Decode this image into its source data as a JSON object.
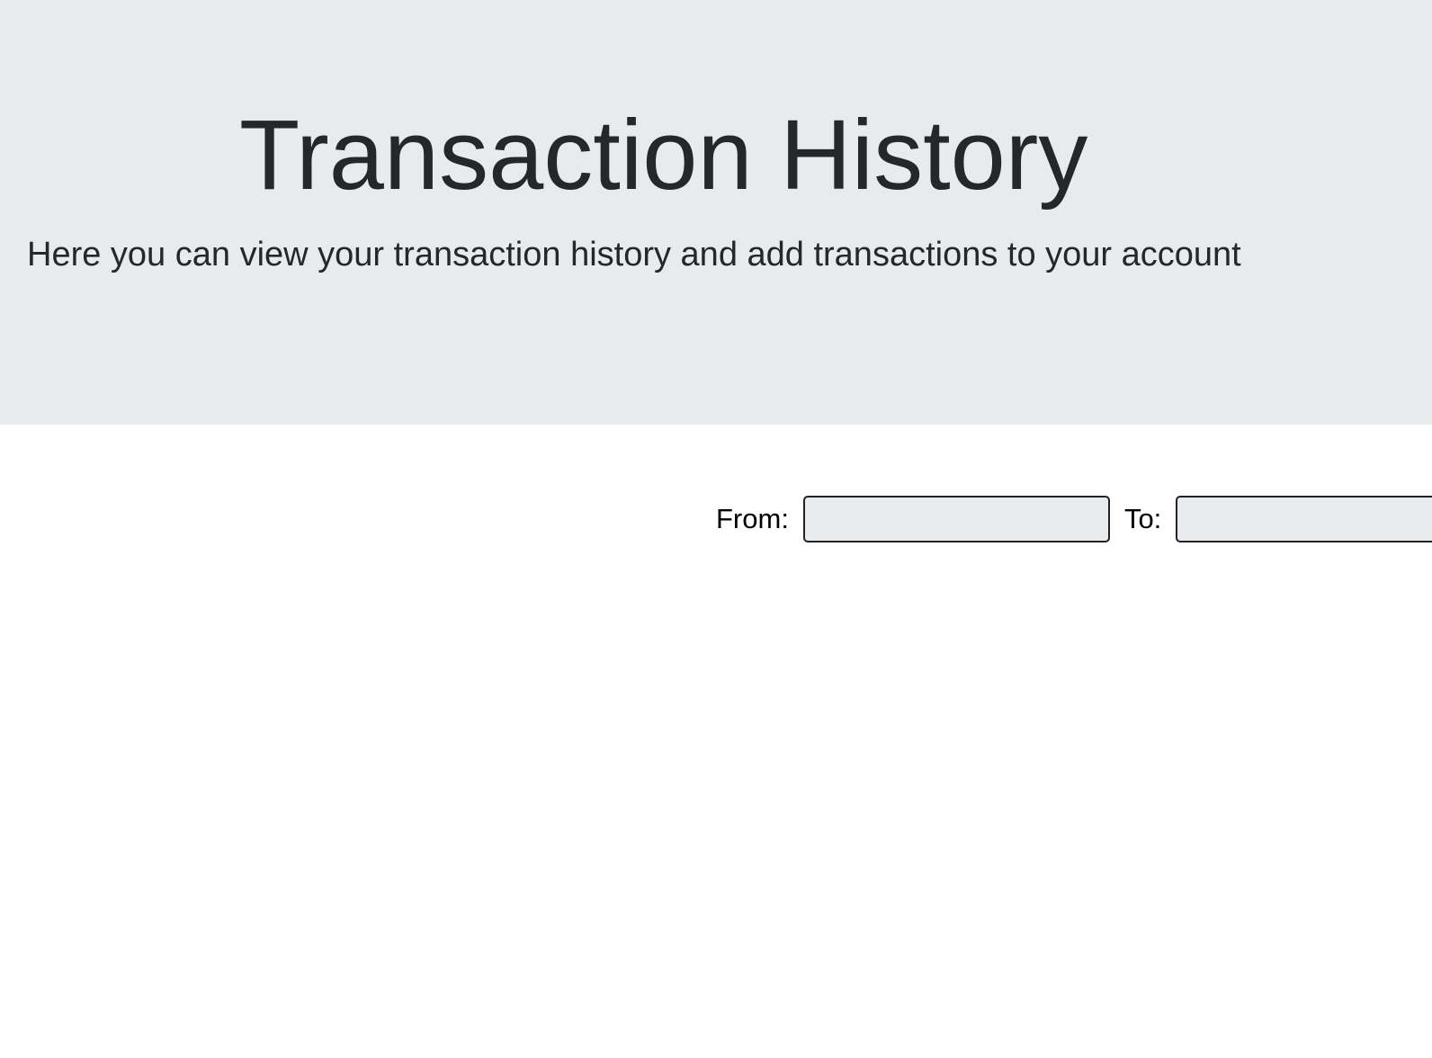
{
  "hero": {
    "title": "Transaction History",
    "lead": "Here you can view your transaction history and add transactions to your account"
  },
  "filter": {
    "from_label": "From:",
    "from_value": "",
    "to_label": "To:",
    "to_value": ""
  },
  "colors": {
    "hero_background": "#e9eaee",
    "text": "#25272b",
    "input_background": "#e9eaee",
    "input_border": "#222222"
  }
}
